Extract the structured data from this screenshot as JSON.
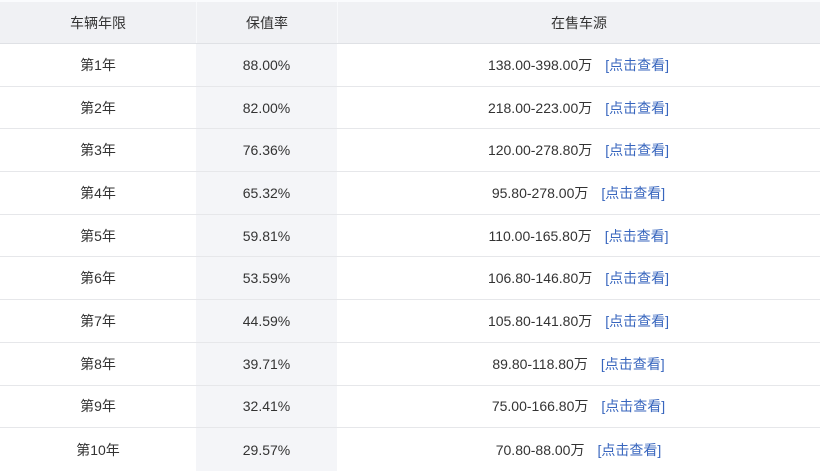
{
  "table": {
    "headers": [
      {
        "label": "车辆年限"
      },
      {
        "label": "保值率"
      },
      {
        "label": "在售车源"
      }
    ],
    "rows": [
      {
        "year": "第1年",
        "rate": "88.00%",
        "price_range": "138.00-398.00万",
        "link_label": "[点击查看]"
      },
      {
        "year": "第2年",
        "rate": "82.00%",
        "price_range": "218.00-223.00万",
        "link_label": "[点击查看]"
      },
      {
        "year": "第3年",
        "rate": "76.36%",
        "price_range": "120.00-278.80万",
        "link_label": "[点击查看]"
      },
      {
        "year": "第4年",
        "rate": "65.32%",
        "price_range": "95.80-278.00万",
        "link_label": "[点击查看]"
      },
      {
        "year": "第5年",
        "rate": "59.81%",
        "price_range": "110.00-165.80万",
        "link_label": "[点击查看]"
      },
      {
        "year": "第6年",
        "rate": "53.59%",
        "price_range": "106.80-146.80万",
        "link_label": "[点击查看]"
      },
      {
        "year": "第7年",
        "rate": "44.59%",
        "price_range": "105.80-141.80万",
        "link_label": "[点击查看]"
      },
      {
        "year": "第8年",
        "rate": "39.71%",
        "price_range": "89.80-118.80万",
        "link_label": "[点击查看]"
      },
      {
        "year": "第9年",
        "rate": "32.41%",
        "price_range": "75.00-166.80万",
        "link_label": "[点击查看]"
      },
      {
        "year": "第10年",
        "rate": "29.57%",
        "price_range": "70.80-88.00万",
        "link_label": "[点击查看]"
      }
    ],
    "colors": {
      "header_bg": "#f0f1f4",
      "rate_column_bg": "#f4f5f8",
      "row_border": "#e6e7ea",
      "header_border": "#dfe1e5",
      "link_blue": "#3866be",
      "text": "#333333"
    }
  }
}
